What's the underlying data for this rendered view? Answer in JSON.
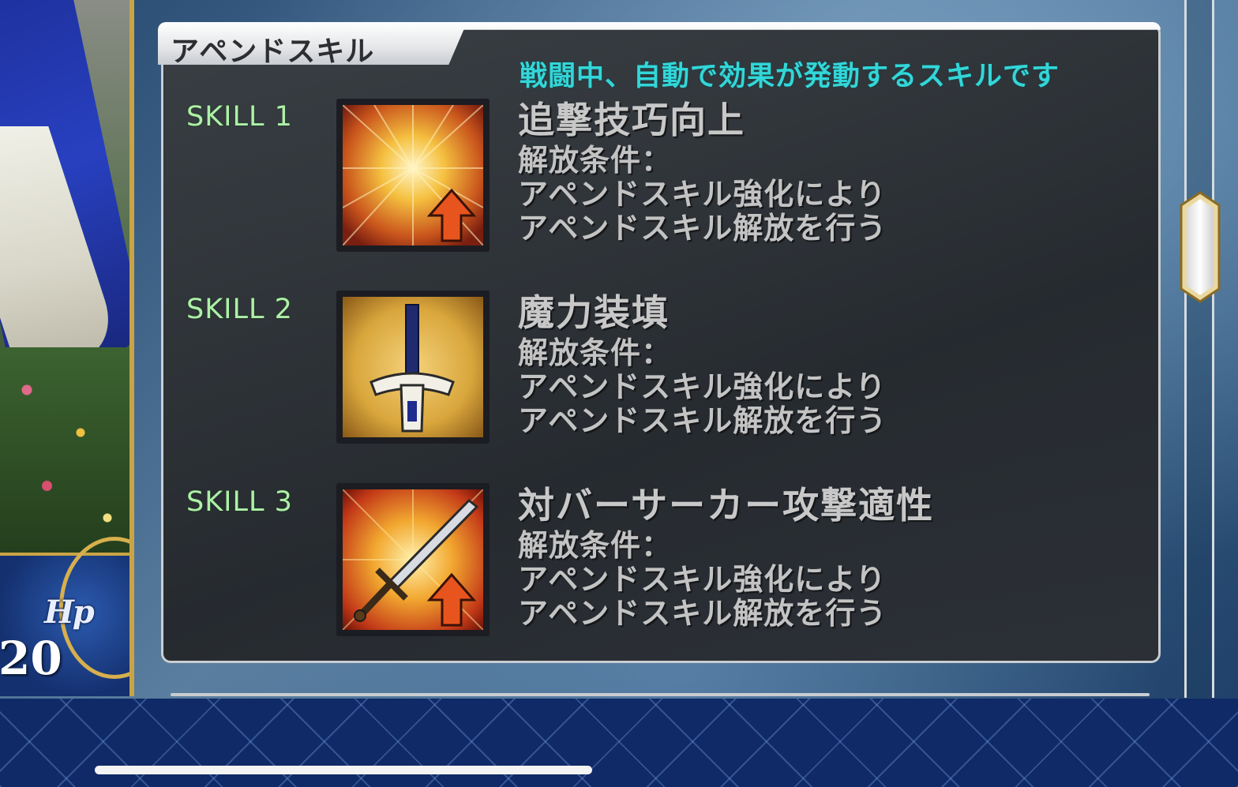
{
  "left_card": {
    "hp_label": "Hp",
    "hp_value": "20"
  },
  "panel": {
    "title": "アペンドスキル",
    "subtitle": "戦闘中、自動で効果が発動するスキルです"
  },
  "skills": [
    {
      "tag": "SKILL 1",
      "name": "追撃技巧向上",
      "icon": "starburst-up-arrow-icon",
      "cond_label": "解放条件：",
      "cond_line1": "アペンドスキル強化により",
      "cond_line2": "アペンドスキル解放を行う"
    },
    {
      "tag": "SKILL 2",
      "name": "魔力装填",
      "icon": "sword-upright-icon",
      "cond_label": "解放条件：",
      "cond_line1": "アペンドスキル強化により",
      "cond_line2": "アペンドスキル解放を行う"
    },
    {
      "tag": "SKILL 3",
      "name": "対バーサーカー攻撃適性",
      "icon": "sword-diagonal-up-arrow-icon",
      "cond_label": "解放条件：",
      "cond_line1": "アペンドスキル強化により",
      "cond_line2": "アペンドスキル解放を行う"
    }
  ],
  "colors": {
    "subtitle": "#33d6d8",
    "skill_tag": "#aef0a8",
    "panel_border": "#c9cdd1",
    "card_gold": "#c9a446"
  }
}
